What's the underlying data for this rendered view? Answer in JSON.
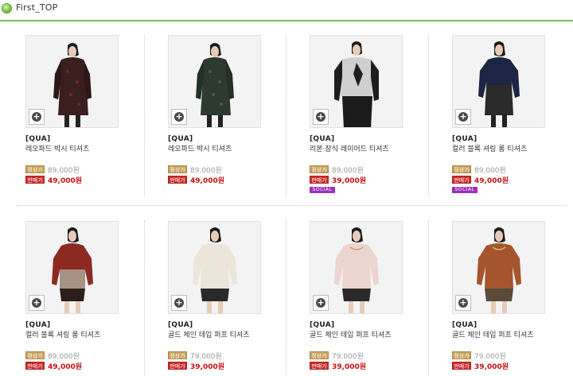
{
  "header": {
    "title": "First_TOP"
  },
  "labels": {
    "regular_tag": "정상가",
    "sale_tag": "판매가",
    "social": "SOCIAL",
    "zoom": "+"
  },
  "colors": {
    "accent_green": "#76c24a",
    "sale_red": "#cc2a2a",
    "regular_gold": "#c9a35a",
    "social_purple": "#9b30b8"
  },
  "products": [
    {
      "brand": "[QUA]",
      "name": "레오파드 박시 티셔츠",
      "regular_price": "89,000원",
      "sale_price": "49,000원",
      "social": false,
      "icon": "zoom-plus-icon"
    },
    {
      "brand": "[QUA]",
      "name": "레오파드 박시 티셔츠",
      "regular_price": "89,000원",
      "sale_price": "49,000원",
      "social": false,
      "icon": "zoom-plus-icon"
    },
    {
      "brand": "[QUA]",
      "name": "리본 장식 레이어드 티셔츠",
      "regular_price": "89,000원",
      "sale_price": "39,000원",
      "social": true,
      "icon": "zoom-plus-icon"
    },
    {
      "brand": "[QUA]",
      "name": "컬러 블록 셔링 롱 티셔츠",
      "regular_price": "89,000원",
      "sale_price": "49,000원",
      "social": true,
      "icon": "zoom-plus-icon"
    },
    {
      "brand": "[QUA]",
      "name": "컬러 블록 셔링 롱 티셔츠",
      "regular_price": "89,000원",
      "sale_price": "49,000원",
      "social": false,
      "icon": "zoom-plus-icon"
    },
    {
      "brand": "[QUA]",
      "name": "골드 체인 테입 퍼프 티셔츠",
      "regular_price": "79,000원",
      "sale_price": "39,000원",
      "social": false,
      "icon": "zoom-plus-icon"
    },
    {
      "brand": "[QUA]",
      "name": "골드 체인 테입 퍼프 티셔츠",
      "regular_price": "79,000원",
      "sale_price": "39,000원",
      "social": false,
      "icon": "zoom-plus-icon"
    },
    {
      "brand": "[QUA]",
      "name": "골드 체인 테입 퍼프 티셔츠",
      "regular_price": "79,000원",
      "sale_price": "39,000원",
      "social": false,
      "icon": "zoom-plus-icon"
    }
  ]
}
